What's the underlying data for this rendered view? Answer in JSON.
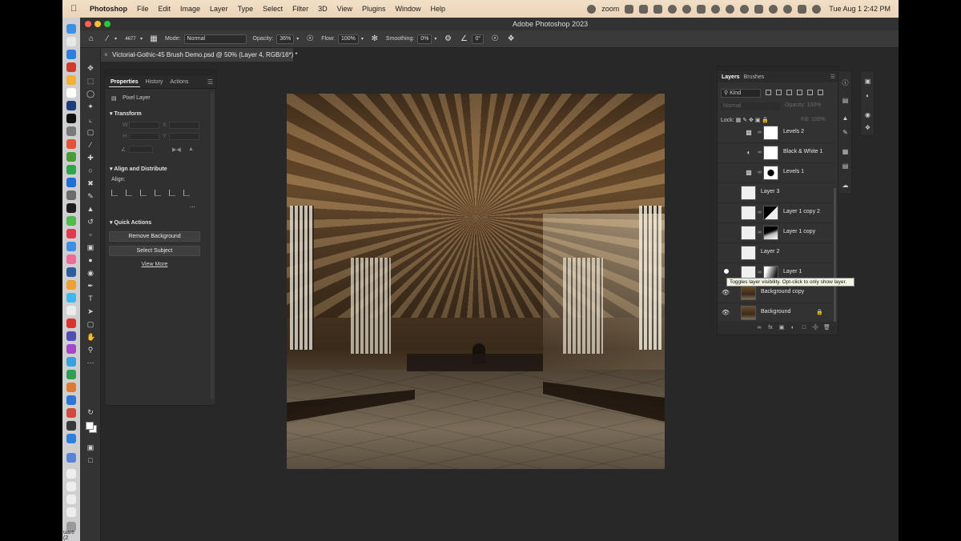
{
  "menubar": {
    "app": "Photoshop",
    "items": [
      "File",
      "Edit",
      "Image",
      "Layer",
      "Type",
      "Select",
      "Filter",
      "3D",
      "View",
      "Plugins",
      "Window",
      "Help"
    ],
    "zoom": "zoom",
    "clock": "Tue Aug 1  2:42 PM"
  },
  "dock": {
    "label": "uare (2"
  },
  "app": {
    "title": "Adobe Photoshop 2023"
  },
  "options": {
    "brush_size": "4677",
    "mode_label": "Mode:",
    "mode_value": "Normal",
    "opacity_label": "Opacity:",
    "opacity_value": "36%",
    "flow_label": "Flow:",
    "flow_value": "100%",
    "smoothing_label": "Smoothing:",
    "smoothing_value": "0%",
    "angle_value": "0°"
  },
  "document": {
    "tab_title": "Victorial-Gothic-45 Brush Demo.psd @ 50% (Layer 4, RGB/16*) *"
  },
  "properties": {
    "tabs": [
      "Properties",
      "History",
      "Actions"
    ],
    "kind": "Pixel Layer",
    "transform_title": "Transform",
    "w_label": "W",
    "h_label": "H",
    "x_label": "X",
    "y_label": "Y",
    "align_title": "Align and Distribute",
    "align_label": "Align:",
    "quick_actions_title": "Quick Actions",
    "remove_bg": "Remove Background",
    "select_subject": "Select Subject",
    "view_more": "View More"
  },
  "layers_panel": {
    "tabs": [
      "Layers",
      "Brushes"
    ],
    "filter": "Kind",
    "blend": "Normal",
    "opacity": "Opacity: 100%",
    "lock_label": "Lock:",
    "fill": "Fill: 100%",
    "layers": [
      {
        "name": "Levels 2"
      },
      {
        "name": "Black & White 1"
      },
      {
        "name": "Levels 1"
      },
      {
        "name": "Layer 3"
      },
      {
        "name": "Layer 1 copy 2"
      },
      {
        "name": "Layer 1 copy"
      },
      {
        "name": "Layer 2"
      },
      {
        "name": "Layer 1"
      },
      {
        "name": "Background copy"
      },
      {
        "name": "Background"
      }
    ],
    "tooltip": "Toggles layer visibility. Opt-click to only show layer."
  }
}
